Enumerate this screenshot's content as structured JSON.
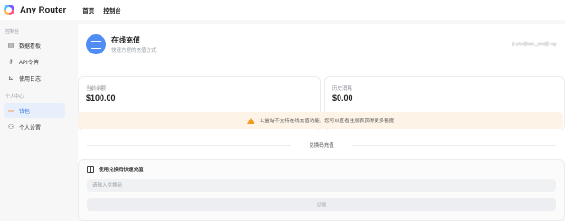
{
  "app": {
    "brand": "Any Router"
  },
  "topnav": {
    "home": "首页",
    "console": "控制台"
  },
  "sidebar": {
    "section_console": "控制台",
    "section_personal": "个人中心",
    "items": [
      {
        "label": "数据看板",
        "icon": "dashboard-icon"
      },
      {
        "label": "API令牌",
        "icon": "key-icon"
      },
      {
        "label": "使用日志",
        "icon": "chart-icon"
      },
      {
        "label": "钱包",
        "icon": "wallet-icon",
        "active": true
      },
      {
        "label": "个人设置",
        "icon": "user-icon"
      }
    ]
  },
  "header": {
    "title": "在线充值",
    "subtitle": "快速方便的充值方式",
    "user_blurred": "ji.ytu@ajo_ytu@.ng"
  },
  "stats": {
    "current_balance_label": "当前余额",
    "current_balance": "$100.00",
    "history_label": "历史消耗",
    "history_value": "$0.00"
  },
  "notice": {
    "text": "公益站不支持在线充值功能，您可以查看注册表获得更多额度"
  },
  "divider": {
    "text": "兑换码充值"
  },
  "redeem": {
    "title": "使用兑换码快速充值",
    "placeholder": "请输入兑换码",
    "button": "兑换"
  },
  "colors": {
    "accent": "#4f8df5",
    "active_bg": "#e7effc",
    "notice_bg": "#fdf3e6",
    "warning": "#f39a1e"
  }
}
